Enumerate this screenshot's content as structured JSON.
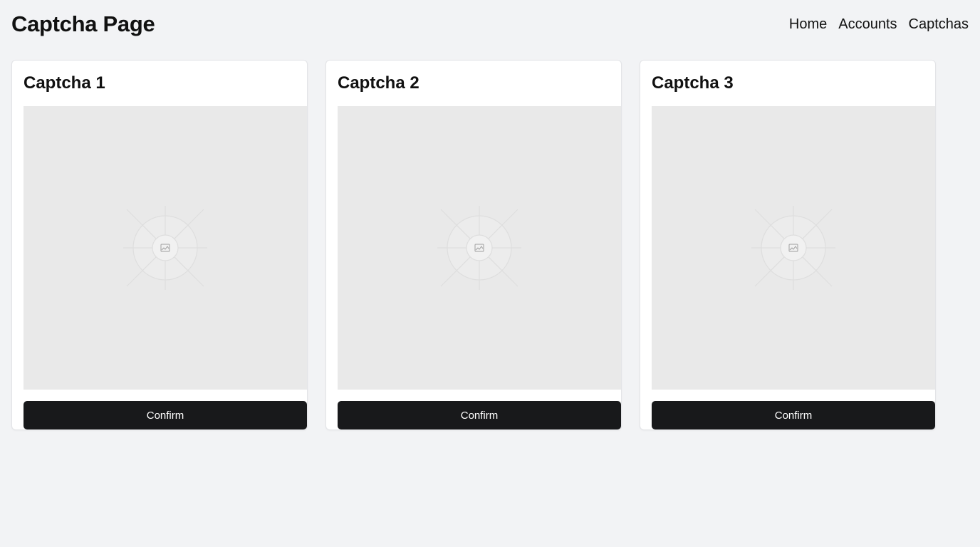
{
  "header": {
    "title": "Captcha Page",
    "nav": [
      "Home",
      "Accounts",
      "Captchas"
    ]
  },
  "cards": [
    {
      "title": "Captcha 1",
      "button_label": "Confirm",
      "image_icon": "image-placeholder-icon"
    },
    {
      "title": "Captcha 2",
      "button_label": "Confirm",
      "image_icon": "image-placeholder-icon"
    },
    {
      "title": "Captcha 3",
      "button_label": "Confirm",
      "image_icon": "image-placeholder-icon"
    }
  ],
  "colors": {
    "page_background": "#f2f3f5",
    "card_background": "#ffffff",
    "image_placeholder": "#e9e9e9",
    "button_background": "#18191b",
    "button_text": "#ffffff"
  }
}
